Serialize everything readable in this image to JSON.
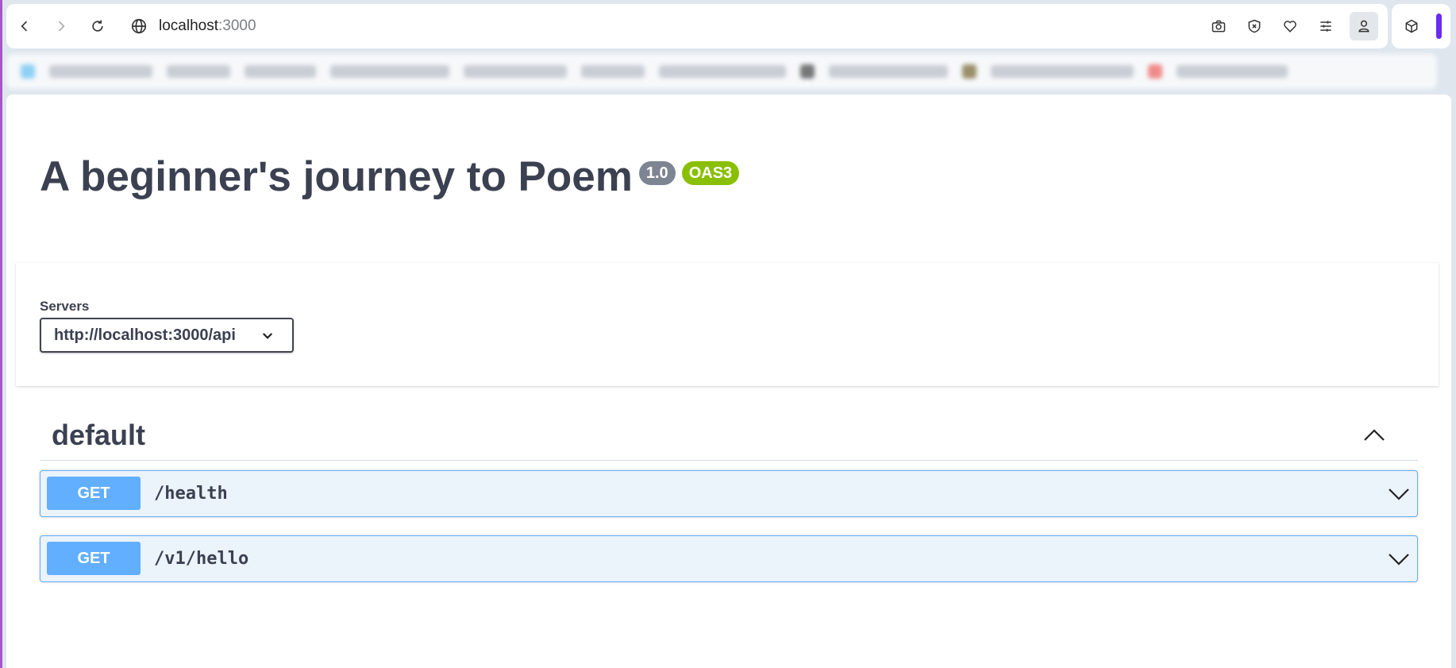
{
  "browser": {
    "url_host": "localhost",
    "url_port": ":3000"
  },
  "api": {
    "title": "A beginner's journey to Poem",
    "version_badge": "1.0",
    "spec_badge": "OAS3"
  },
  "servers": {
    "label": "Servers",
    "selected": "http://localhost:3000/api"
  },
  "tag": {
    "name": "default"
  },
  "operations": [
    {
      "method": "GET",
      "path": "/health"
    },
    {
      "method": "GET",
      "path": "/v1/hello"
    }
  ],
  "colors": {
    "get_accent": "#61affe",
    "oas_badge": "#89bf04",
    "version_badge": "#7d8492"
  }
}
